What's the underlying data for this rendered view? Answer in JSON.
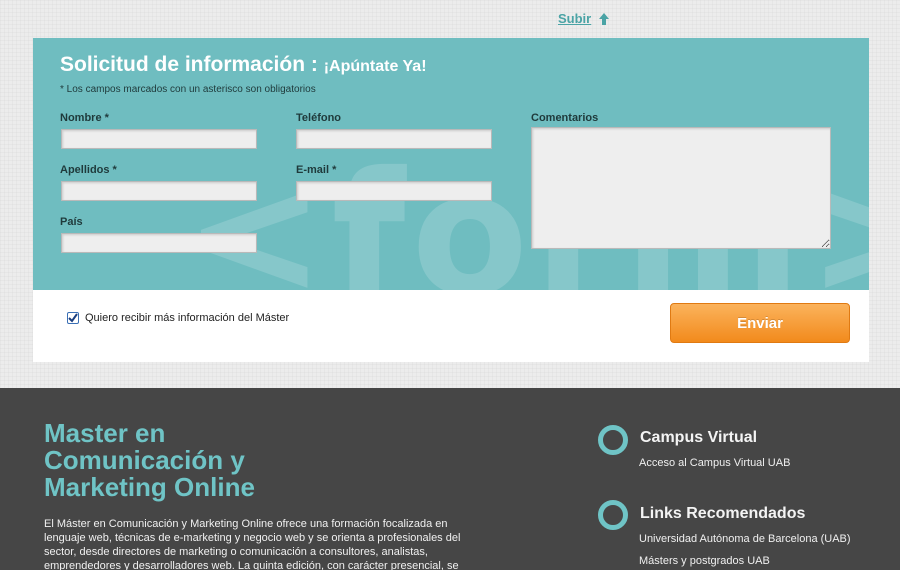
{
  "top_link": {
    "label": "Subir"
  },
  "form": {
    "title": "Solicitud de información :",
    "title_sub": "¡Apúntate Ya!",
    "note": "* Los campos marcados con un asterisco son obligatorios",
    "watermark": "<form>",
    "fields": {
      "nombre": {
        "label": "Nombre *",
        "value": ""
      },
      "telefono": {
        "label": "Teléfono",
        "value": ""
      },
      "comentarios": {
        "label": "Comentarios",
        "value": ""
      },
      "apellidos": {
        "label": "Apellidos *",
        "value": ""
      },
      "email": {
        "label": "E-mail *",
        "value": ""
      },
      "pais": {
        "label": "País",
        "value": ""
      }
    },
    "checkbox": {
      "label": "Quiero recibir más información del Máster",
      "checked": true
    },
    "submit_label": "Enviar"
  },
  "footer": {
    "title": "Master en Comunicación y Marketing Online",
    "description": "El Máster en Comunicación y Marketing Online ofrece una formación focalizada en lenguaje web, técnicas de e-marketing y negocio web y se orienta a profesionales del sector, desde directores de marketing o comunicación a consultores, analistas, emprendedores y desarrolladores web. La quinta edición, con carácter presencial, se",
    "campus": {
      "heading": "Campus Virtual",
      "links": [
        "Acceso al Campus Virtual UAB"
      ]
    },
    "recomendados": {
      "heading": "Links Recomendados",
      "links": [
        "Universidad Autónoma de Barcelona (UAB)",
        "Másters y postgrados UAB"
      ]
    }
  },
  "colors": {
    "accent": "#6fc4c6",
    "form_bg": "#6fbdc0",
    "button": "#f28a1c",
    "footer_bg": "#464646"
  }
}
